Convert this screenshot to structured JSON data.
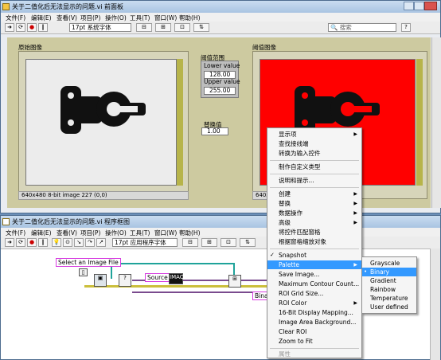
{
  "front_panel": {
    "title": "关于二值化后无法显示的问题.vi 前面板",
    "menus": [
      "文件(F)",
      "编辑(E)",
      "查看(V)",
      "项目(P)",
      "操作(O)",
      "工具(T)",
      "窗口(W)",
      "帮助(H)"
    ],
    "font_select": "17pt 系统字体",
    "search_placeholder": "搜索",
    "original_image_label": "原始图像",
    "threshold_image_label": "阈值图像",
    "threshold_range_label": "阈值范围",
    "lower_value_label": "Lower value",
    "lower_value": "128.00",
    "upper_value_label": "Upper value",
    "upper_value": "255.00",
    "replace_value_label": "替换值",
    "replace_value": "1.00",
    "status_left": "640x480 8-bit image 227      (0,0)",
    "status_right": "640x480 8-b"
  },
  "block_diagram": {
    "title": "关于二值化后无法显示的问题.vi 程序框图",
    "menus": [
      "文件(F)",
      "编辑(E)",
      "查看(V)",
      "项目(P)",
      "操作(O)",
      "工具(T)",
      "窗口(W)",
      "帮助(H)"
    ],
    "font_select": "17pt 应用程序字体",
    "select_file_label": "Select an Image File",
    "source_label": "Source",
    "imaq_label": "IMAQ",
    "binary_label": "Binar"
  },
  "context_menu": {
    "items": [
      "显示项",
      "查找接线端",
      "转换为输入控件",
      "制作自定义类型",
      "说明和提示...",
      "创建",
      "替换",
      "数据操作",
      "高级",
      "将控件匹配窗格",
      "根据窗格缩放对象",
      "Snapshot",
      "Palette",
      "Save Image...",
      "Maximum Contour Count...",
      "ROI Grid Size...",
      "ROI Color",
      "16-Bit Display Mapping...",
      "Image Area Background...",
      "Clear ROI",
      "Zoom to Fit",
      "属性"
    ]
  },
  "palette_submenu": {
    "items": [
      "Grayscale",
      "Binary",
      "Gradient",
      "Rainbow",
      "Temperature",
      "User defined"
    ],
    "selected": "Binary"
  },
  "colors": {
    "panel_bg": "#cdcaa0",
    "threshold_fill": "#ff0000",
    "selection": "#3399ff",
    "label_border": "#d63be0"
  }
}
